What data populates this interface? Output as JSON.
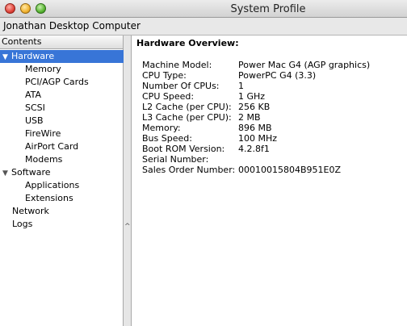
{
  "window": {
    "title": "System Profile"
  },
  "computer_name": "Jonathan Desktop Computer",
  "sidebar": {
    "header": "Contents",
    "items": [
      {
        "label": "Hardware",
        "expanded": true,
        "selected": true
      },
      {
        "label": "Memory"
      },
      {
        "label": "PCI/AGP Cards"
      },
      {
        "label": "ATA"
      },
      {
        "label": "SCSI"
      },
      {
        "label": "USB"
      },
      {
        "label": "FireWire"
      },
      {
        "label": "AirPort Card"
      },
      {
        "label": "Modems"
      },
      {
        "label": "Software",
        "expanded": true
      },
      {
        "label": "Applications"
      },
      {
        "label": "Extensions"
      },
      {
        "label": "Network"
      },
      {
        "label": "Logs"
      }
    ]
  },
  "main": {
    "title": "Hardware Overview:",
    "rows": [
      {
        "label": "Machine Model:",
        "value": "Power Mac G4 (AGP graphics)"
      },
      {
        "label": "CPU Type:",
        "value": "PowerPC G4  (3.3)"
      },
      {
        "label": "Number Of CPUs:",
        "value": "1"
      },
      {
        "label": "CPU Speed:",
        "value": "1 GHz"
      },
      {
        "label": "L2 Cache (per CPU):",
        "value": "256 KB"
      },
      {
        "label": "L3 Cache (per CPU):",
        "value": "2 MB"
      },
      {
        "label": "Memory:",
        "value": "896 MB"
      },
      {
        "label": "Bus Speed:",
        "value": "100 MHz"
      },
      {
        "label": "Boot ROM Version:",
        "value": "4.2.8f1"
      },
      {
        "label": "Serial Number:",
        "value": ""
      },
      {
        "label": "Sales Order Number:",
        "value": "00010015804B951E0Z"
      }
    ]
  },
  "colors": {
    "selection": "#3875d7"
  }
}
